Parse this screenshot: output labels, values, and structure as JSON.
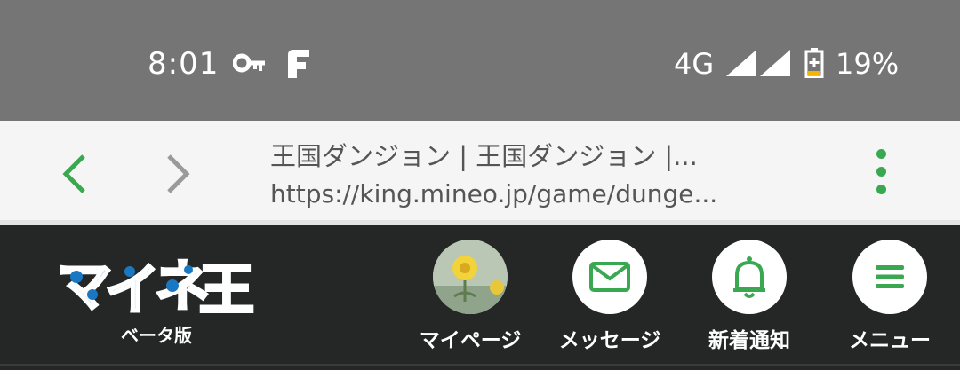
{
  "status_bar": {
    "time": "8:01",
    "network": "4G",
    "battery": "19%",
    "icons": [
      "vpn-key-icon",
      "app-f-icon",
      "signal-icon",
      "signal-icon",
      "battery-icon"
    ]
  },
  "browser": {
    "title": "王国ダンジョン | 王国ダンジョン |...",
    "url": "https://king.mineo.jp/game/dunge...",
    "accent_color": "#3aa850"
  },
  "site_header": {
    "logo_text": "マイネ王",
    "logo_sub": "ベータ版",
    "nav": [
      {
        "label": "マイページ",
        "icon": "avatar-icon"
      },
      {
        "label": "メッセージ",
        "icon": "mail-icon"
      },
      {
        "label": "新着通知",
        "icon": "bell-icon"
      },
      {
        "label": "メニュー",
        "icon": "hamburger-icon"
      }
    ]
  }
}
